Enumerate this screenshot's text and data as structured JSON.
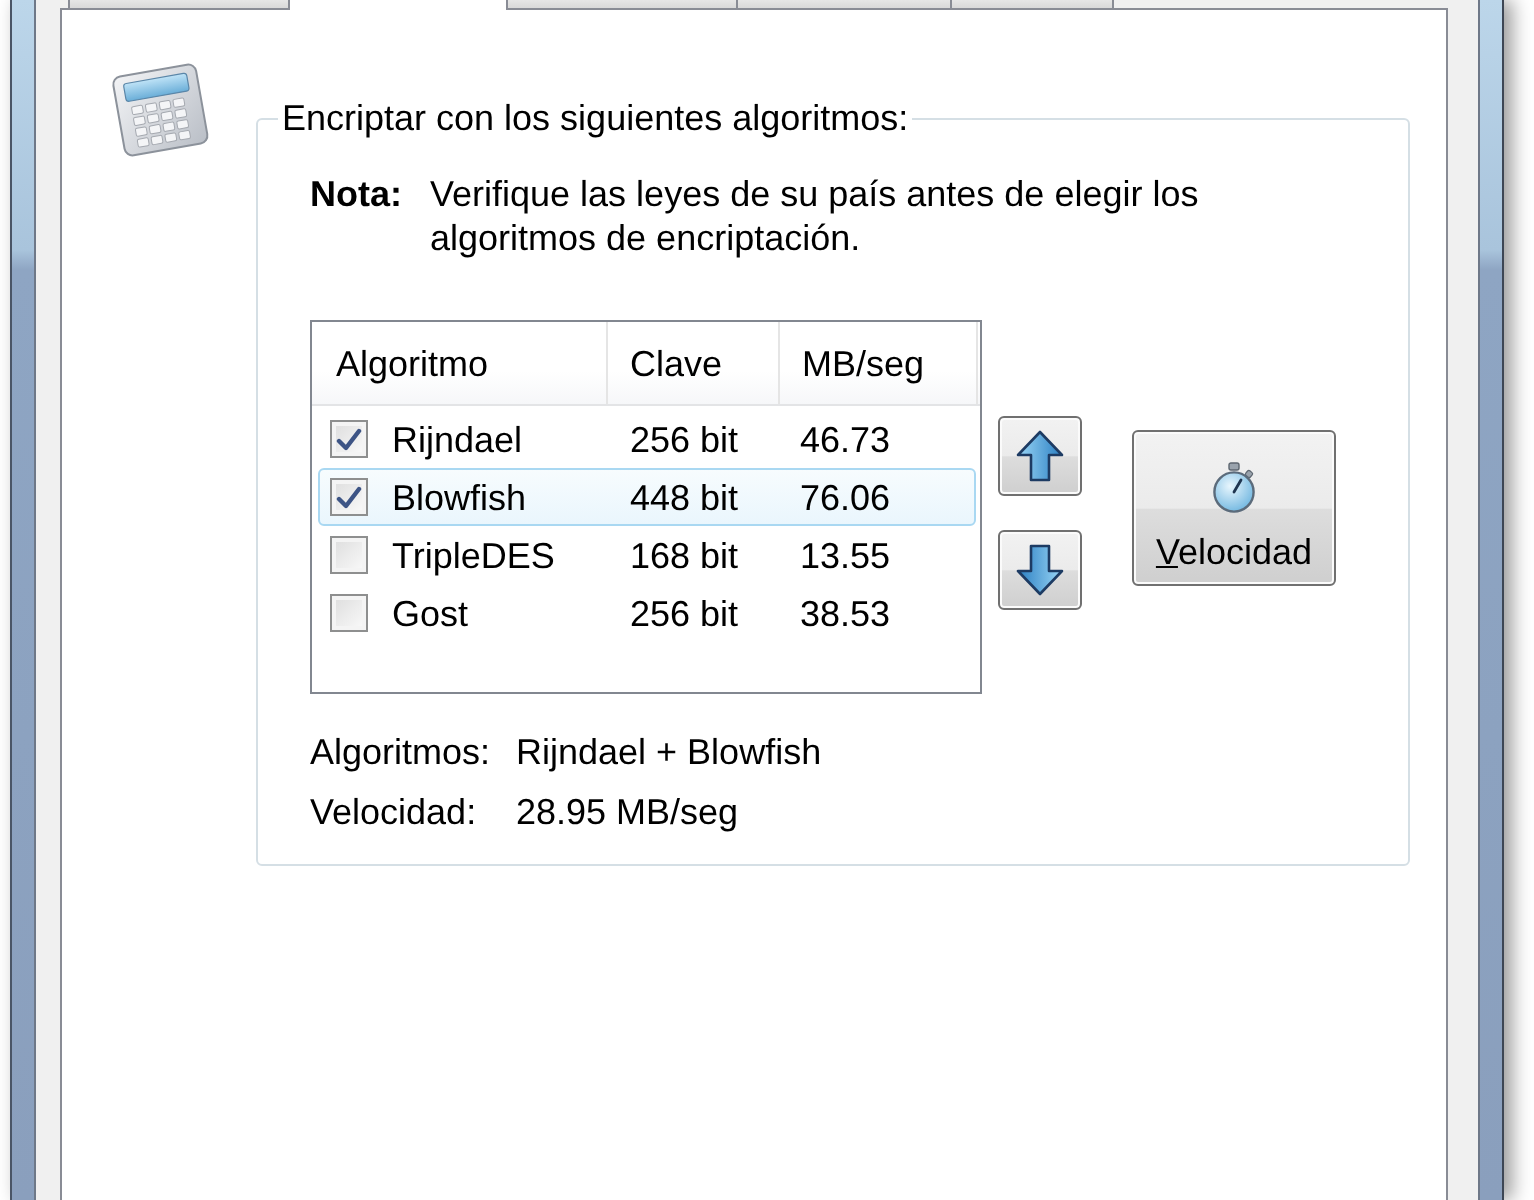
{
  "tabs": [
    {
      "selected": false
    },
    {
      "selected": true
    },
    {
      "selected": false
    },
    {
      "selected": false
    },
    {
      "selected": false
    }
  ],
  "group": {
    "title": "Encriptar con los siguientes algoritmos:",
    "note": {
      "label": "Nota:",
      "text": "Verifique las leyes de su país antes de elegir los algoritmos de encriptación."
    },
    "algorithm_list": {
      "columns": [
        "Algoritmo",
        "Clave",
        "MB/seg"
      ],
      "rows": [
        {
          "name": "Rijndael",
          "key": "256 bit",
          "speed": "46.73",
          "checked": true,
          "selected": false
        },
        {
          "name": "Blowfish",
          "key": "448 bit",
          "speed": "76.06",
          "checked": true,
          "selected": true
        },
        {
          "name": "TripleDES",
          "key": "168 bit",
          "speed": "13.55",
          "checked": false,
          "selected": false
        },
        {
          "name": "Gost",
          "key": "256 bit",
          "speed": "38.53",
          "checked": false,
          "selected": false
        }
      ]
    },
    "speed_button": {
      "label": "Velocidad",
      "access_key_underlined": true
    },
    "summary": [
      {
        "label": "Algoritmos:",
        "value": "Rijndael + Blowfish"
      },
      {
        "label": "Velocidad:",
        "value": "28.95 MB/seg"
      }
    ]
  }
}
